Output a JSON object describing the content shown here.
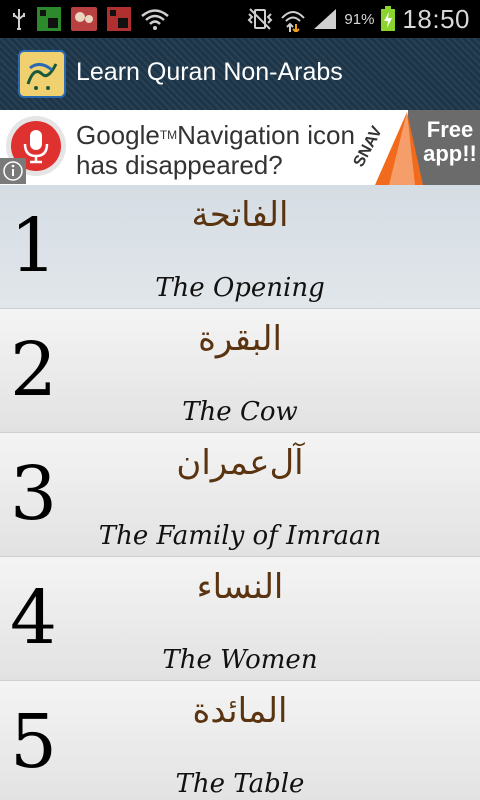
{
  "status_bar": {
    "battery_percent": "91%",
    "time": "18:50",
    "icons_left": [
      "usb-icon",
      "app-notification-icon",
      "app-notification-icon",
      "app-notification-icon",
      "wifi-icon"
    ],
    "icons_right": [
      "vibrate-mute-icon",
      "data-transfer-icon",
      "signal-icon",
      "battery-charging-icon"
    ]
  },
  "app_bar": {
    "title": "Learn Quran Non-Arabs",
    "icon": "app-logo-icon"
  },
  "ad": {
    "line1": "Google",
    "tm": "TM",
    "line1_rest": "Navigation icon",
    "line2": "has disappeared?",
    "brand": "SNAV",
    "cta_line1": "Free",
    "cta_line2": "app!!"
  },
  "surahs": [
    {
      "number": "1",
      "arabic": "الفاتحة",
      "english": "The Opening"
    },
    {
      "number": "2",
      "arabic": "البقرة",
      "english": "The Cow"
    },
    {
      "number": "3",
      "arabic": "آل‌عمران",
      "english": "The Family of Imraan"
    },
    {
      "number": "4",
      "arabic": "النساء",
      "english": "The Women"
    },
    {
      "number": "5",
      "arabic": "المائدة",
      "english": "The Table"
    }
  ],
  "colors": {
    "title_bar": "#1c3548",
    "arabic_text": "#5a3411",
    "ad_mic": "#e03131"
  }
}
